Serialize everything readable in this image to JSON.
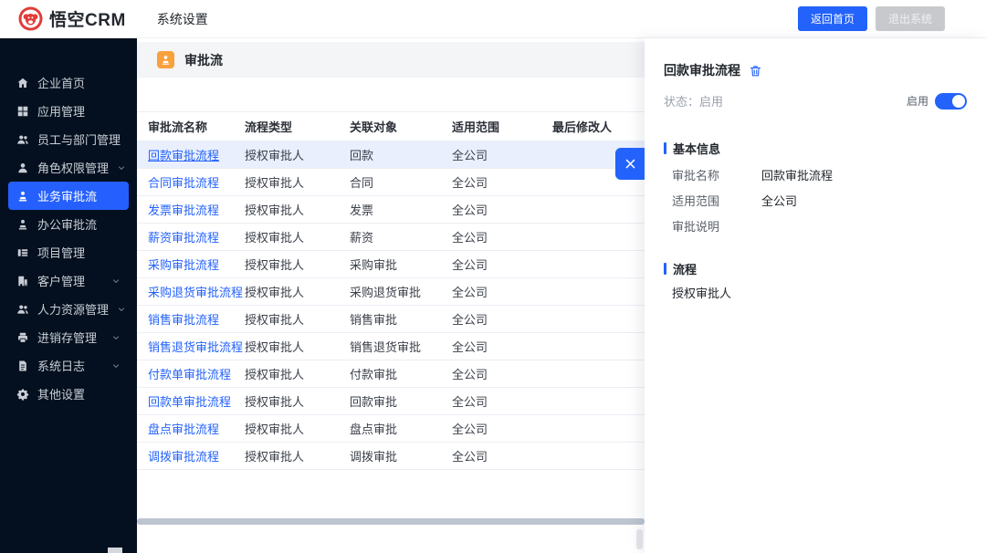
{
  "header": {
    "logo_text": "悟空CRM",
    "title": "系统设置",
    "back_home_label": "返回首页",
    "logout_label": "退出系统"
  },
  "sidebar": {
    "items": [
      {
        "label": "企业首页",
        "icon": "home-icon",
        "expandable": false,
        "active": false
      },
      {
        "label": "应用管理",
        "icon": "grid-icon",
        "expandable": false,
        "active": false
      },
      {
        "label": "员工与部门管理",
        "icon": "users-icon",
        "expandable": false,
        "active": false
      },
      {
        "label": "角色权限管理",
        "icon": "user-icon",
        "expandable": true,
        "active": false
      },
      {
        "label": "业务审批流",
        "icon": "stamp-icon",
        "expandable": false,
        "active": true
      },
      {
        "label": "办公审批流",
        "icon": "stamp-icon",
        "expandable": false,
        "active": false
      },
      {
        "label": "项目管理",
        "icon": "project-icon",
        "expandable": false,
        "active": false
      },
      {
        "label": "客户管理",
        "icon": "building-icon",
        "expandable": true,
        "active": false
      },
      {
        "label": "人力资源管理",
        "icon": "users-icon",
        "expandable": true,
        "active": false
      },
      {
        "label": "进销存管理",
        "icon": "inventory-icon",
        "expandable": true,
        "active": false
      },
      {
        "label": "系统日志",
        "icon": "log-icon",
        "expandable": true,
        "active": false
      },
      {
        "label": "其他设置",
        "icon": "gear-icon",
        "expandable": false,
        "active": false
      }
    ]
  },
  "page": {
    "title": "审批流"
  },
  "table": {
    "columns": [
      "审批流名称",
      "流程类型",
      "关联对象",
      "适用范围",
      "最后修改人"
    ],
    "rows": [
      {
        "name": "回款审批流程",
        "type": "授权审批人",
        "object": "回款",
        "scope": "全公司",
        "modifier": "",
        "selected": true
      },
      {
        "name": "合同审批流程",
        "type": "授权审批人",
        "object": "合同",
        "scope": "全公司",
        "modifier": "",
        "selected": false
      },
      {
        "name": "发票审批流程",
        "type": "授权审批人",
        "object": "发票",
        "scope": "全公司",
        "modifier": "",
        "selected": false
      },
      {
        "name": "薪资审批流程",
        "type": "授权审批人",
        "object": "薪资",
        "scope": "全公司",
        "modifier": "",
        "selected": false
      },
      {
        "name": "采购审批流程",
        "type": "授权审批人",
        "object": "采购审批",
        "scope": "全公司",
        "modifier": "",
        "selected": false
      },
      {
        "name": "采购退货审批流程",
        "type": "授权审批人",
        "object": "采购退货审批",
        "scope": "全公司",
        "modifier": "",
        "selected": false
      },
      {
        "name": "销售审批流程",
        "type": "授权审批人",
        "object": "销售审批",
        "scope": "全公司",
        "modifier": "",
        "selected": false
      },
      {
        "name": "销售退货审批流程",
        "type": "授权审批人",
        "object": "销售退货审批",
        "scope": "全公司",
        "modifier": "",
        "selected": false
      },
      {
        "name": "付款单审批流程",
        "type": "授权审批人",
        "object": "付款审批",
        "scope": "全公司",
        "modifier": "",
        "selected": false
      },
      {
        "name": "回款单审批流程",
        "type": "授权审批人",
        "object": "回款审批",
        "scope": "全公司",
        "modifier": "",
        "selected": false
      },
      {
        "name": "盘点审批流程",
        "type": "授权审批人",
        "object": "盘点审批",
        "scope": "全公司",
        "modifier": "",
        "selected": false
      },
      {
        "name": "调拨审批流程",
        "type": "授权审批人",
        "object": "调拨审批",
        "scope": "全公司",
        "modifier": "",
        "selected": false
      }
    ]
  },
  "panel": {
    "title": "回款审批流程",
    "status_text": "状态：启用",
    "toggle_label": "启用",
    "toggle_on": true,
    "basic_section_title": "基本信息",
    "fields": [
      {
        "label": "审批名称",
        "value": "回款审批流程"
      },
      {
        "label": "适用范围",
        "value": "全公司"
      },
      {
        "label": "审批说明",
        "value": ""
      }
    ],
    "flow_section_title": "流程",
    "flow_value": "授权审批人"
  },
  "colors": {
    "accent": "#2362fb",
    "sidebar_bg": "#04101f",
    "sidebar_active": "#2560fe",
    "selected_row_bg": "#e9effd",
    "page_header_bg": "#f4f5f7",
    "page_icon_orange": "#f9a13c",
    "logo_red": "#e23c39",
    "scrollbar": "#bdc5d1",
    "gray_button_bg": "#c8c9cc"
  }
}
